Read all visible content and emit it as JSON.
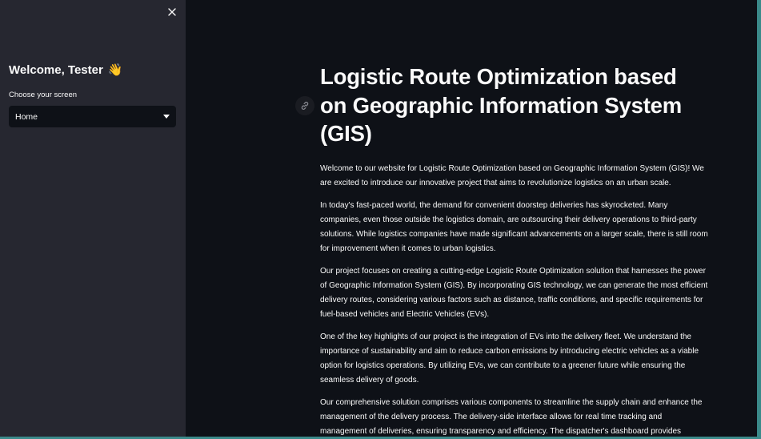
{
  "sidebar": {
    "welcome": "Welcome, Tester",
    "wave_emoji": "👋",
    "select_label": "Choose your screen",
    "select_value": "Home",
    "background_color": "#262730"
  },
  "main": {
    "title": "Logistic Route Optimization based on Geographic Information System (GIS)",
    "paragraphs": [
      "Welcome to our website for Logistic Route Optimization based on Geographic Information System (GIS)! We are excited to introduce our innovative project that aims to revolutionize logistics on an urban scale.",
      "In today's fast-paced world, the demand for convenient doorstep deliveries has skyrocketed. Many companies, even those outside the logistics domain, are outsourcing their delivery operations to third-party solutions. While logistics companies have made significant advancements on a larger scale, there is still room for improvement when it comes to urban logistics.",
      "Our project focuses on creating a cutting-edge Logistic Route Optimization solution that harnesses the power of Geographic Information System (GIS). By incorporating GIS technology, we can generate the most efficient delivery routes, considering various factors such as distance, traffic conditions, and specific requirements for fuel-based vehicles and Electric Vehicles (EVs).",
      "One of the key highlights of our project is the integration of EVs into the delivery fleet. We understand the importance of sustainability and aim to reduce carbon emissions by introducing electric vehicles as a viable option for logistics operations. By utilizing EVs, we can contribute to a greener future while ensuring the seamless delivery of goods.",
      "Our comprehensive solution comprises various components to streamline the supply chain and enhance the management of the delivery process. The delivery-side interface allows for real time tracking and management of deliveries, ensuring transparency and efficiency. The dispatcher's dashboard provides"
    ],
    "background_color": "#0e1117"
  },
  "icons": {
    "close": "close-icon",
    "dropdown": "chevron-down-icon",
    "anchor": "link-icon"
  }
}
